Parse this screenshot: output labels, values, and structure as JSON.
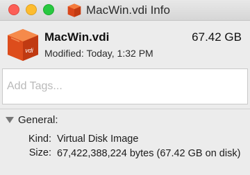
{
  "window": {
    "title": "MacWin.vdi Info"
  },
  "file": {
    "name": "MacWin.vdi",
    "size_short": "67.42 GB",
    "modified_label": "Modified:",
    "modified_value": "Today, 1:32 PM",
    "icon": "virtualbox-disk-icon",
    "icon_badge": "vdi"
  },
  "tags": {
    "placeholder": "Add Tags..."
  },
  "general": {
    "title": "General:",
    "kind_label": "Kind:",
    "kind_value": "Virtual Disk Image",
    "size_label": "Size:",
    "size_value": "67,422,388,224 bytes (67.42 GB on disk)"
  },
  "colors": {
    "close": "#fc5f57",
    "minimize": "#fdbc2e",
    "maximize": "#28c840",
    "icon_orange": "#e8541d"
  }
}
